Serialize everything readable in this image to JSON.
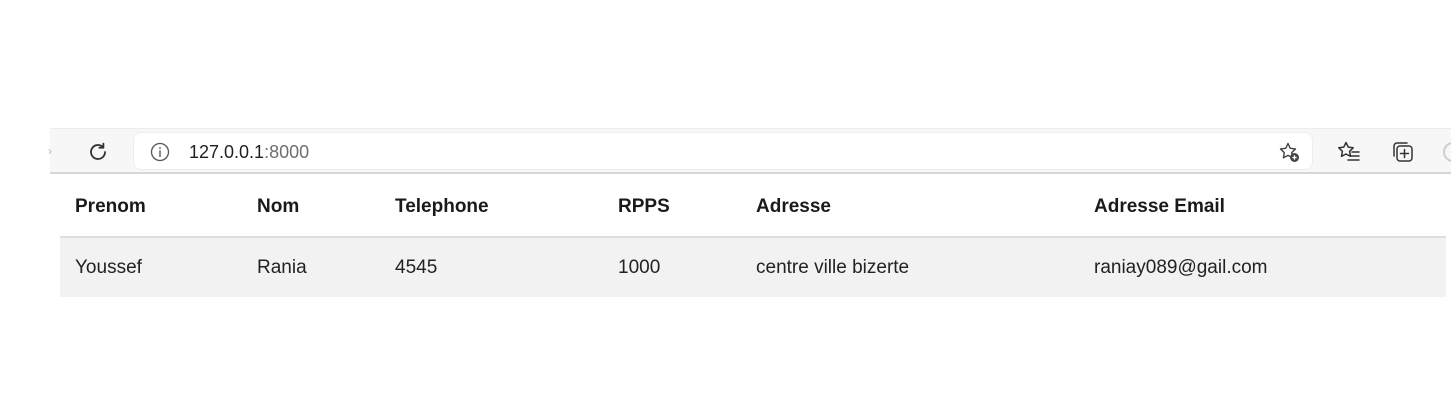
{
  "browser": {
    "url_host": "127.0.0.1",
    "url_port": ":8000",
    "icons": {
      "reload": "reload-icon",
      "info": "info-icon",
      "add_favorite": "star-plus-icon",
      "favorites": "favorites-icon",
      "collections": "collections-icon"
    }
  },
  "table": {
    "headers": [
      "Prenom",
      "Nom",
      "Telephone",
      "RPPS",
      "Adresse",
      "Adresse Email"
    ],
    "rows": [
      [
        "Youssef",
        "Rania",
        "4545",
        "1000",
        "centre ville bizerte",
        "raniay089@gail.com"
      ]
    ]
  },
  "colors": {
    "row_background": "#f2f2f2",
    "toolbar_background": "#f7f7f7"
  }
}
